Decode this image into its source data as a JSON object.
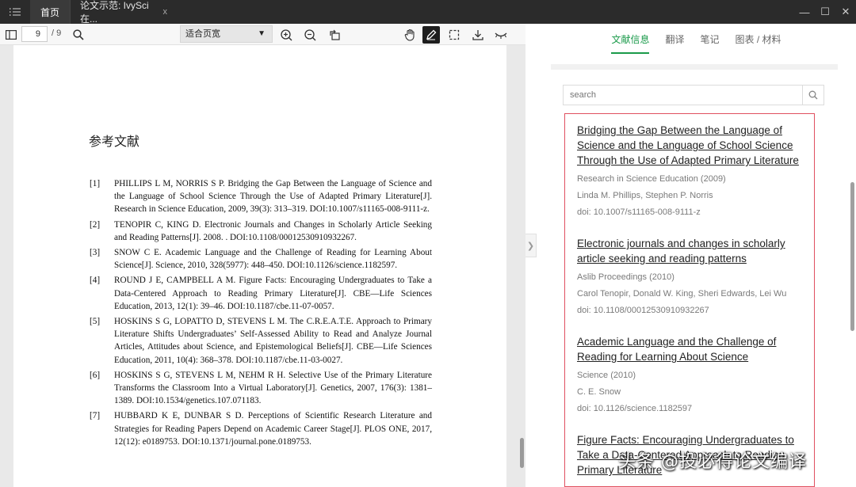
{
  "titlebar": {
    "home_tab": "首页",
    "doc_tab": "论文示范: IvySci 在...",
    "doc_tab_close": "x",
    "minimize": "—",
    "maximize": "☐",
    "close": "✕"
  },
  "toolbar": {
    "page_current": "9",
    "page_total": "/ 9",
    "zoom_mode": "适合页宽"
  },
  "pdf": {
    "heading": "参考文献",
    "references": [
      {
        "num": "[1]",
        "text": "PHILLIPS L M, NORRIS S P. Bridging the Gap Between the Language of Science and the Language of School Science Through the Use of Adapted Primary Literature[J]. Research in Science Education, 2009, 39(3): 313–319. DOI:10.1007/s11165-008-9111-z."
      },
      {
        "num": "[2]",
        "text": "TENOPIR C, KING D. Electronic Journals and Changes in Scholarly Article Seeking and Reading Patterns[J]. 2008. . DOI:10.1108/00012530910932267."
      },
      {
        "num": "[3]",
        "text": "SNOW C E. Academic Language and the Challenge of Reading for Learning About Science[J]. Science, 2010, 328(5977): 448–450. DOI:10.1126/science.1182597."
      },
      {
        "num": "[4]",
        "text": "ROUND J E, CAMPBELL A M. Figure Facts: Encouraging Undergraduates to Take a Data-Centered Approach to Reading Primary Literature[J]. CBE—Life Sciences Education, 2013, 12(1): 39–46. DOI:10.1187/cbe.11-07-0057."
      },
      {
        "num": "[5]",
        "text": "HOSKINS S G, LOPATTO D, STEVENS L M. The C.R.E.A.T.E. Approach to Primary Literature Shifts Undergraduates’ Self-Assessed Ability to Read and Analyze Journal Articles, Attitudes about Science, and Epistemological Beliefs[J]. CBE—Life Sciences Education, 2011, 10(4): 368–378. DOI:10.1187/cbe.11-03-0027."
      },
      {
        "num": "[6]",
        "text": "HOSKINS S G, STEVENS L M, NEHM R H. Selective Use of the Primary Literature Transforms the Classroom Into a Virtual Laboratory[J]. Genetics, 2007, 176(3): 1381–1389. DOI:10.1534/genetics.107.071183."
      },
      {
        "num": "[7]",
        "text": "HUBBARD K E, DUNBAR S D. Perceptions of Scientific Research Literature and Strategies for Reading Papers Depend on Academic Career Stage[J]. PLOS ONE, 2017, 12(12): e0189753. DOI:10.1371/journal.pone.0189753."
      }
    ]
  },
  "panel": {
    "tabs": [
      "文献信息",
      "翻译",
      "笔记",
      "图表 / 材料"
    ],
    "search_placeholder": "search",
    "items": [
      {
        "title": "Bridging the Gap Between the Language of Science and the Language of School Science Through the Use of Adapted Primary Literature",
        "source": "Research in Science Education (2009)",
        "authors": "Linda M. Phillips, Stephen P. Norris",
        "doi": "doi: 10.1007/s11165-008-9111-z"
      },
      {
        "title": "Electronic journals and changes in scholarly article seeking and reading patterns",
        "source": "Aslib Proceedings (2010)",
        "authors": "Carol Tenopir, Donald W. King, Sheri Edwards, Lei Wu",
        "doi": "doi: 10.1108/00012530910932267"
      },
      {
        "title": "Academic Language and the Challenge of Reading for Learning About Science",
        "source": "Science (2010)",
        "authors": "C. E. Snow",
        "doi": "doi: 10.1126/science.1182597"
      },
      {
        "title": "Figure Facts: Encouraging Undergraduates to Take a Data-Centered Approach to Reading Primary Literature",
        "source": "",
        "authors": "",
        "doi": ""
      }
    ]
  },
  "watermark": "头条 @投必得论文编译"
}
